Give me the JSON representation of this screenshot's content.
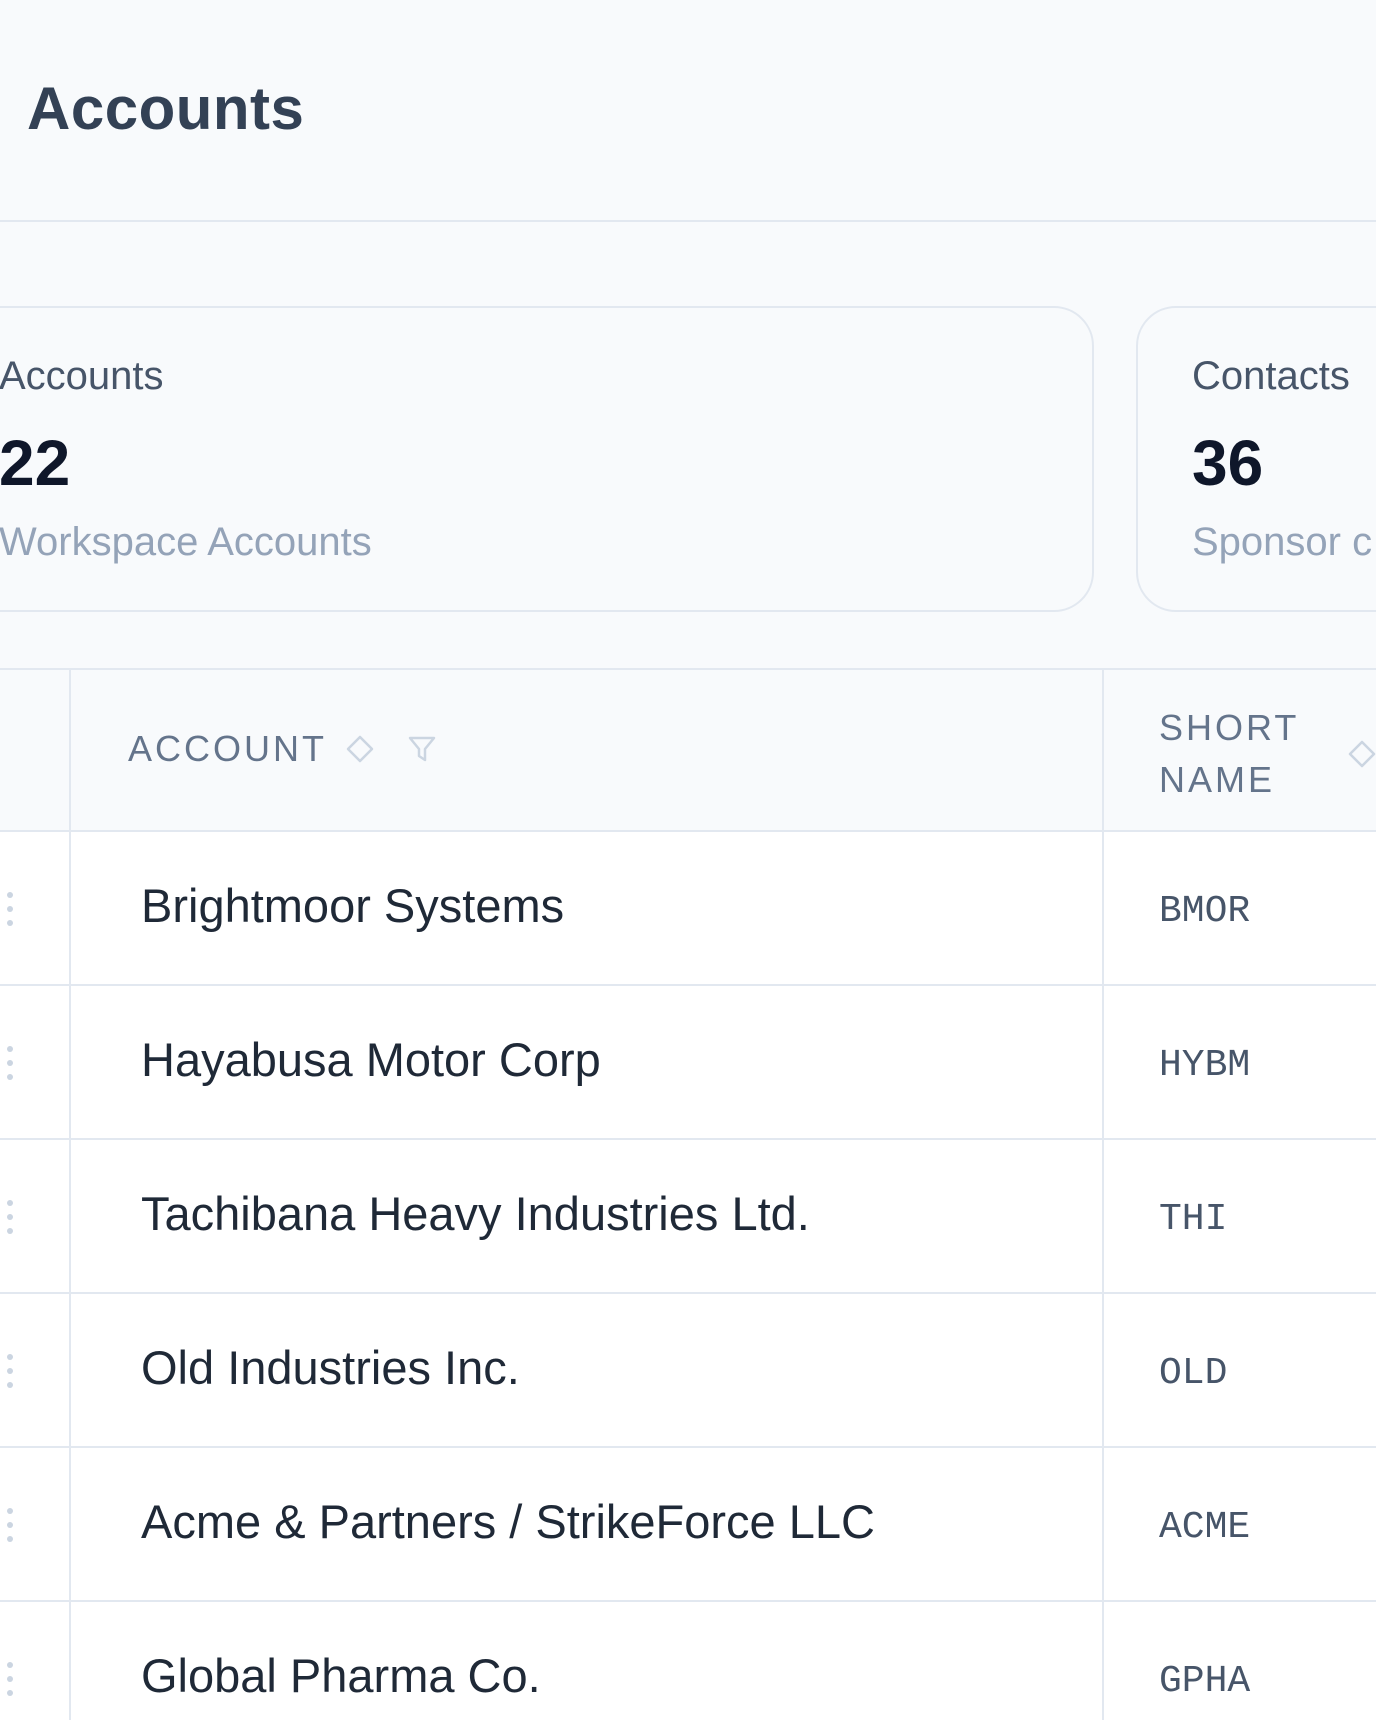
{
  "header": {
    "title": "Accounts"
  },
  "stats": [
    {
      "label": "Accounts",
      "value": "22",
      "sub": "Workspace Accounts"
    },
    {
      "label": "Contacts",
      "value": "36",
      "sub": "Sponsor c"
    }
  ],
  "table": {
    "columns": [
      {
        "label": "ACCOUNT",
        "sort_icon": "sort-icon",
        "filter_icon": "filter-icon"
      },
      {
        "label": "SHORT NAME",
        "sort_icon": "sort-icon"
      }
    ],
    "rows": [
      {
        "account": "Brightmoor Systems",
        "short": "BMOR"
      },
      {
        "account": "Hayabusa Motor Corp",
        "short": "HYBM"
      },
      {
        "account": "Tachibana Heavy Industries Ltd.",
        "short": "THI"
      },
      {
        "account": "Old Industries Inc.",
        "short": "OLD"
      },
      {
        "account": "Acme & Partners / StrikeForce LLC",
        "short": "ACME"
      },
      {
        "account": "Global Pharma Co.",
        "short": "GPHA"
      }
    ]
  },
  "colors": {
    "background": "#f8fafc",
    "border": "#e2e8f0",
    "title": "#334155",
    "muted": "#94a3b8"
  }
}
